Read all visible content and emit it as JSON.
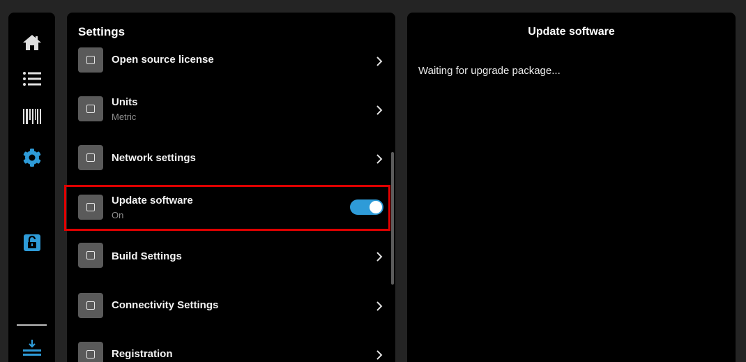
{
  "nav": {
    "items": [
      {
        "name": "home-icon",
        "active": false
      },
      {
        "name": "list-icon",
        "active": false
      },
      {
        "name": "barcode-icon",
        "active": false
      },
      {
        "name": "gear-icon",
        "active": true
      },
      {
        "name": "unlock-icon",
        "active": true
      },
      {
        "name": "download-icon",
        "active": true
      }
    ],
    "active_color": "#2e9bd8"
  },
  "settings": {
    "title": "Settings",
    "items": [
      {
        "title": "Open source license",
        "subtitle": "",
        "control": "chevron"
      },
      {
        "title": "Units",
        "subtitle": "Metric",
        "control": "chevron"
      },
      {
        "title": "Network settings",
        "subtitle": "",
        "control": "chevron"
      },
      {
        "title": "Update software",
        "subtitle": "On",
        "control": "toggle",
        "toggle_on": true,
        "highlighted": true
      },
      {
        "title": "Build Settings",
        "subtitle": "",
        "control": "chevron"
      },
      {
        "title": "Connectivity Settings",
        "subtitle": "",
        "control": "chevron"
      },
      {
        "title": "Registration",
        "subtitle": "",
        "control": "chevron"
      }
    ]
  },
  "detail": {
    "title": "Update software",
    "message": "Waiting for upgrade package..."
  },
  "colors": {
    "highlight": "#e00000",
    "toggle": "#2e9bd8"
  }
}
